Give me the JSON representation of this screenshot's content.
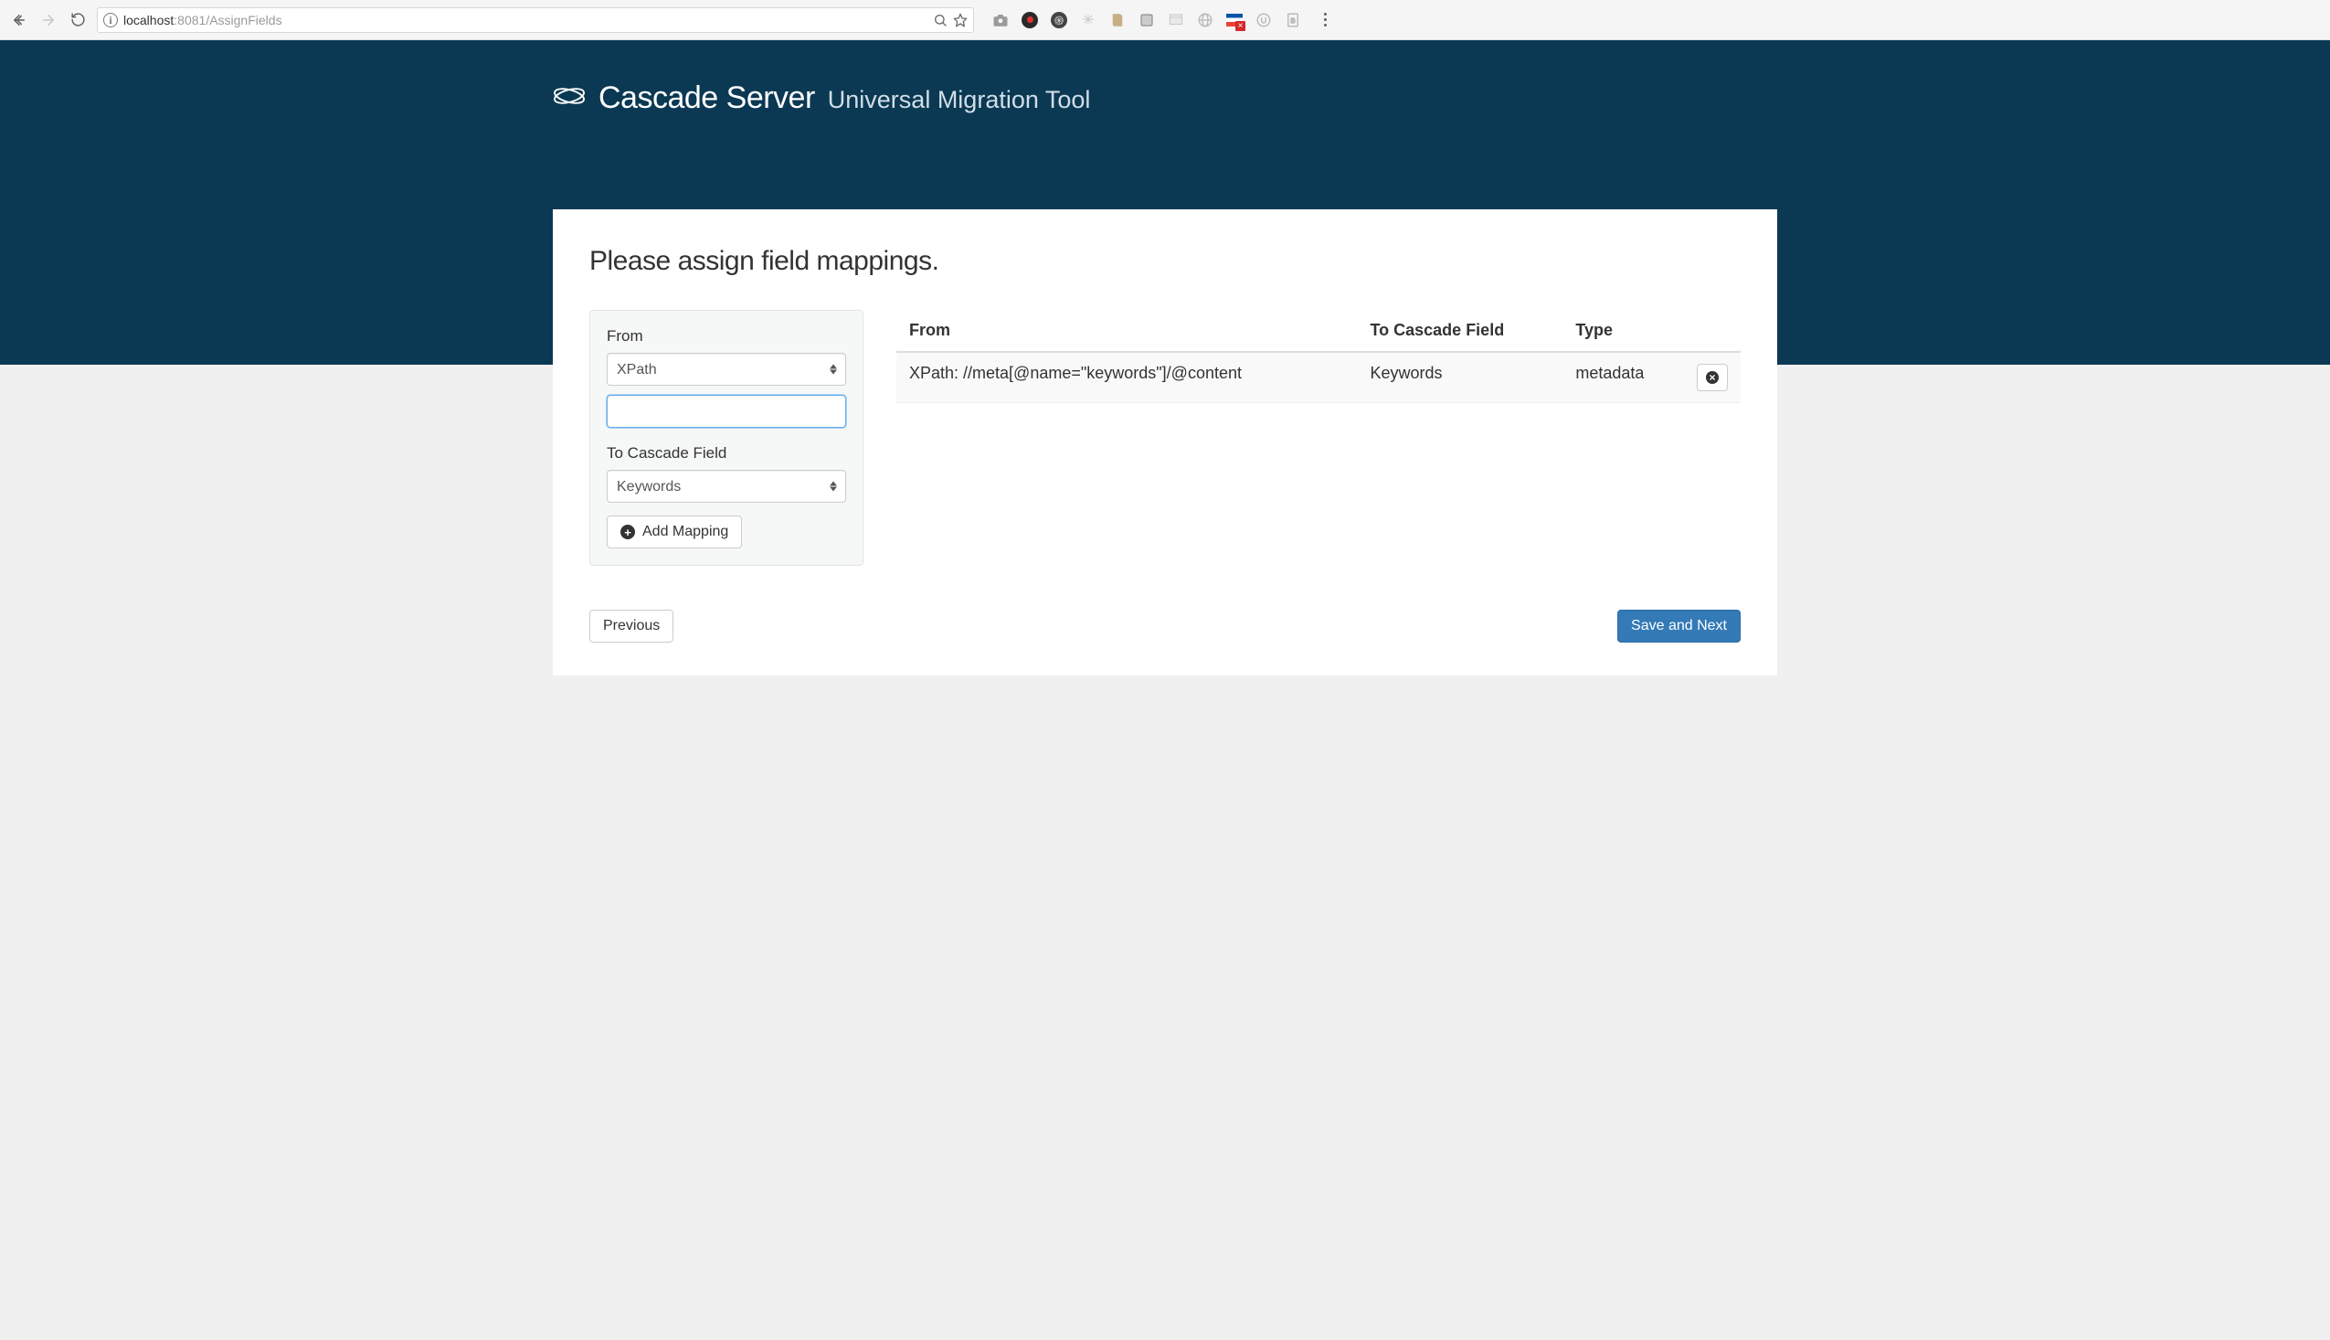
{
  "chrome": {
    "url_host": "localhost",
    "url_port": ":8081",
    "url_path": "/AssignFields"
  },
  "brand": {
    "title": "Cascade Server",
    "subtitle": "Universal Migration Tool"
  },
  "page": {
    "heading": "Please assign field mappings."
  },
  "form": {
    "from_label": "From",
    "from_select_value": "XPath",
    "from_input_value": "",
    "to_label": "To Cascade Field",
    "to_select_value": "Keywords",
    "add_button_label": "Add Mapping"
  },
  "table": {
    "headers": {
      "from": "From",
      "to": "To Cascade Field",
      "type": "Type"
    },
    "rows": [
      {
        "from": "XPath: //meta[@name=\"keywords\"]/@content",
        "to": "Keywords",
        "type": "metadata"
      }
    ]
  },
  "footer": {
    "previous_label": "Previous",
    "next_label": "Save and Next"
  }
}
